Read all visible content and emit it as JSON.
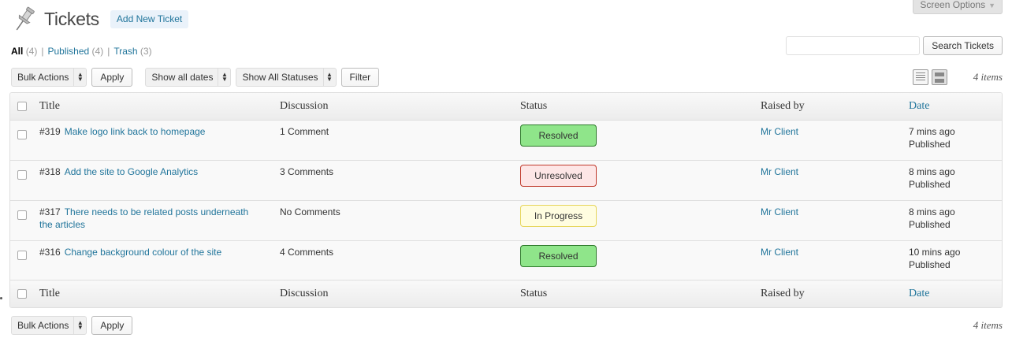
{
  "header": {
    "title": "Tickets",
    "add_new_label": "Add New Ticket",
    "screen_options_label": "Screen Options",
    "icon": "pushpin-icon"
  },
  "subsub": [
    {
      "label": "All",
      "count": "(4)",
      "current": true
    },
    {
      "label": "Published",
      "count": "(4)",
      "current": false
    },
    {
      "label": "Trash",
      "count": "(3)",
      "current": false
    }
  ],
  "search": {
    "value": "",
    "button_label": "Search Tickets"
  },
  "tablenav_top": {
    "bulk_actions": "Bulk Actions",
    "apply_label": "Apply",
    "dates_filter": "Show all dates",
    "status_filter": "Show All Statuses",
    "filter_label": "Filter",
    "items_count": "4 items"
  },
  "tablenav_bottom": {
    "bulk_actions": "Bulk Actions",
    "apply_label": "Apply",
    "items_count": "4 items"
  },
  "columns": {
    "title": "Title",
    "discussion": "Discussion",
    "status": "Status",
    "raised_by": "Raised by",
    "date": "Date"
  },
  "rows": [
    {
      "id": "#319",
      "title": "Make logo link back to homepage",
      "discussion": "1 Comment",
      "status": "Resolved",
      "status_type": "resolved",
      "raised_by": "Mr Client",
      "date": "7 mins ago",
      "state": "Published"
    },
    {
      "id": "#318",
      "title": "Add the site to Google Analytics",
      "discussion": "3 Comments",
      "status": "Unresolved",
      "status_type": "unresolved",
      "raised_by": "Mr Client",
      "date": "8 mins ago",
      "state": "Published"
    },
    {
      "id": "#317",
      "title": "There needs to be related posts underneath the articles",
      "discussion": "No Comments",
      "status": "In Progress",
      "status_type": "inprogress",
      "raised_by": "Mr Client",
      "date": "8 mins ago",
      "state": "Published"
    },
    {
      "id": "#316",
      "title": "Change background colour of the site",
      "discussion": "4 Comments",
      "status": "Resolved",
      "status_type": "resolved",
      "raised_by": "Mr Client",
      "date": "10 mins ago",
      "state": "Published"
    }
  ],
  "colors": {
    "link": "#21759b",
    "resolved": "#8fe58a",
    "unresolved": "#fde6e6",
    "in_progress": "#fffde0"
  }
}
